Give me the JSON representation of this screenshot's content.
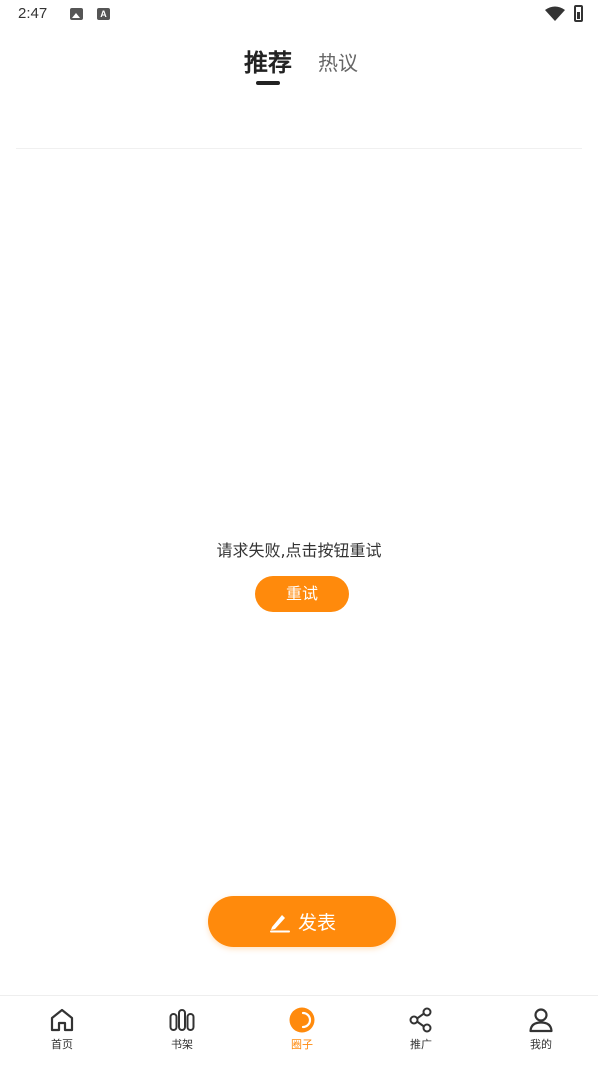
{
  "status_bar": {
    "time": "2:47"
  },
  "tabs": [
    {
      "label": "推荐",
      "active": true
    },
    {
      "label": "热议",
      "active": false
    }
  ],
  "error": {
    "message": "请求失败,点击按钮重试",
    "retry_label": "重试"
  },
  "publish": {
    "label": "发表"
  },
  "bottom_nav": [
    {
      "label": "首页",
      "icon": "home-icon",
      "active": false
    },
    {
      "label": "书架",
      "icon": "bookshelf-icon",
      "active": false
    },
    {
      "label": "圈子",
      "icon": "circle-icon",
      "active": true
    },
    {
      "label": "推广",
      "icon": "share-icon",
      "active": false
    },
    {
      "label": "我的",
      "icon": "user-icon",
      "active": false
    }
  ],
  "colors": {
    "accent": "#ff8a0c",
    "text": "#222222",
    "muted": "#666666"
  }
}
